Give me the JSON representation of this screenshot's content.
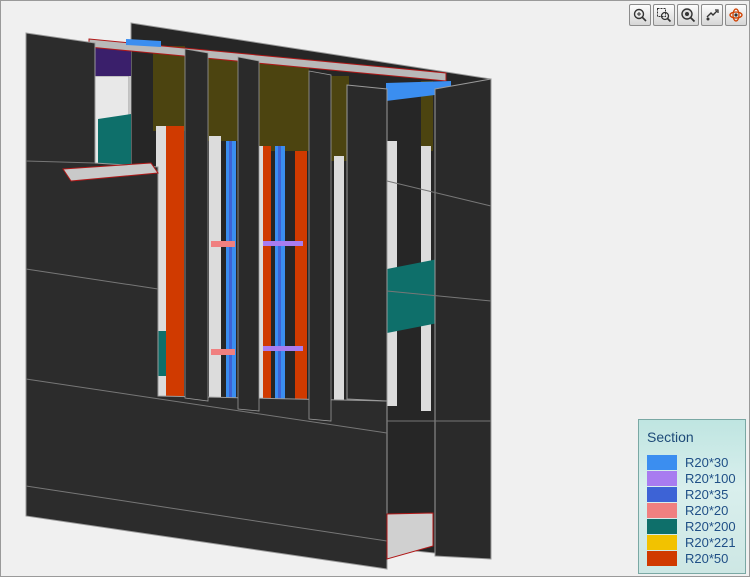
{
  "toolbar": {
    "buttons": [
      {
        "icon": "zoom-in-icon"
      },
      {
        "icon": "zoom-window-icon"
      },
      {
        "icon": "zoom-extents-icon"
      },
      {
        "icon": "pan-icon"
      },
      {
        "icon": "orbit-icon"
      }
    ]
  },
  "legend": {
    "title": "Section",
    "items": [
      {
        "label": "R20*30",
        "color": "#3b8ef0"
      },
      {
        "label": "R20*100",
        "color": "#a87cf0"
      },
      {
        "label": "R20*35",
        "color": "#3d63d6"
      },
      {
        "label": "R20*20",
        "color": "#f08080"
      },
      {
        "label": "R20*200",
        "color": "#0e6f6a"
      },
      {
        "label": "R20*221",
        "color": "#f2c200"
      },
      {
        "label": "R20*50",
        "color": "#d03a00"
      }
    ]
  },
  "colors": {
    "panel": "#2b2b2b",
    "panel_edge": "#9a9a9a",
    "timber": "#4c4410",
    "section_outline": "#b01818"
  }
}
